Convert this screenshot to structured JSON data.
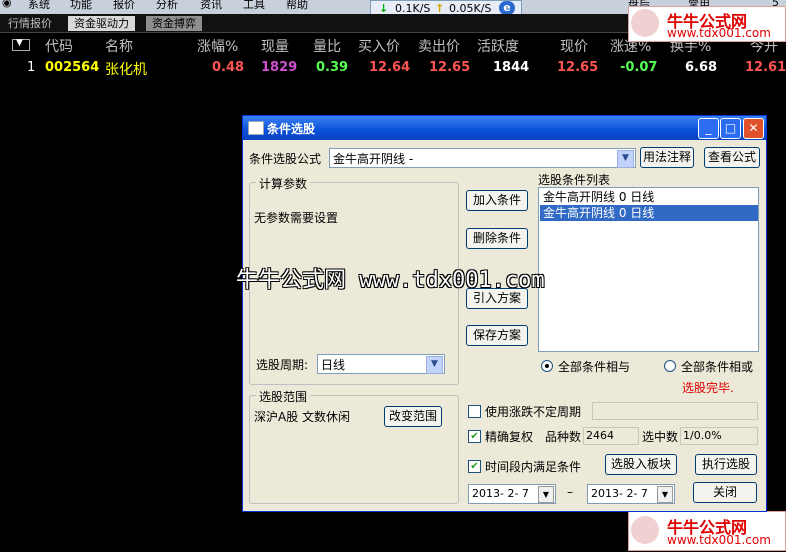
{
  "menu": [
    "系统",
    "功能",
    "报价",
    "分析",
    "资讯",
    "工具",
    "帮助"
  ],
  "network": {
    "down": "0.1K/S",
    "up": "0.05K/S",
    "down_arrow": "↓",
    "up_arrow": "↑",
    "ie_glyph": "e"
  },
  "tabs": [
    {
      "label": "行情报价",
      "active": false
    },
    {
      "label": "资金驱动力",
      "active": true
    },
    {
      "label": "资金搏弈",
      "active": false
    }
  ],
  "topright_text": [
    "盘后",
    "常用",
    "5"
  ],
  "table": {
    "headers": [
      "代码",
      "名称",
      "涨幅%",
      "现量",
      "量比",
      "买入价",
      "卖出价",
      "活跃度",
      "现价",
      "涨速%",
      "换手%",
      "今开"
    ],
    "rows": [
      {
        "index": "1",
        "code": "002564",
        "name": "张化机",
        "change_pct": "0.48",
        "volume": "1829",
        "vol_ratio": "0.39",
        "bid": "12.64",
        "ask": "12.65",
        "activity": "1844",
        "price": "12.65",
        "speed": "-0.07",
        "turnover": "6.68",
        "open": "12.61"
      }
    ]
  },
  "colors": {
    "up": "#ff5454",
    "down": "#54ff54",
    "code": "#ffff00",
    "volume": "#d050d0",
    "neutral": "#ffffff"
  },
  "watermark": {
    "line1": "牛牛公式网",
    "line2": "www.tdx001.com",
    "overlay": "牛牛公式网 www.tdx001.com"
  },
  "dialog": {
    "title": "条件选股",
    "formula_label": "条件选股公式",
    "formula_value": "金牛高开阴线 -",
    "usage_button": "用法注释",
    "view_button": "查看公式",
    "params_group": "计算参数",
    "params_text": "无参数需要设置",
    "period_label": "选股周期:",
    "period_value": "日线",
    "scope_group": "选股范围",
    "scope_text": "深沪A股 文数休闲",
    "change_scope_button": "改变范围",
    "add_button": "加入条件",
    "delete_button": "删除条件",
    "import_button": "引入方案",
    "save_button": "保存方案",
    "list_label": "选股条件列表",
    "conditions": [
      {
        "text": "金牛高开阴线  0  日线",
        "selected": false
      },
      {
        "text": "金牛高开阴线  0  日线",
        "selected": true
      }
    ],
    "radio_and": "全部条件相与",
    "radio_or": "全部条件相或",
    "status": "选股完毕.",
    "use_period_label": "使用涨跌不定周期",
    "exact_restore_label": "精确复权",
    "stock_count_label": "品种数",
    "stock_count_value": "2464",
    "selected_count_label": "选中数",
    "selected_count_value": "1/0.0%",
    "time_range_label": "时间段内满足条件",
    "to_block_button": "选股入板块",
    "execute_button": "执行选股",
    "date_from": "2013- 2- 7",
    "date_sep": "–",
    "date_to": "2013- 2- 7",
    "close_button": "关闭",
    "use_period_checked": false,
    "exact_restore_checked": true,
    "time_range_checked": true
  }
}
